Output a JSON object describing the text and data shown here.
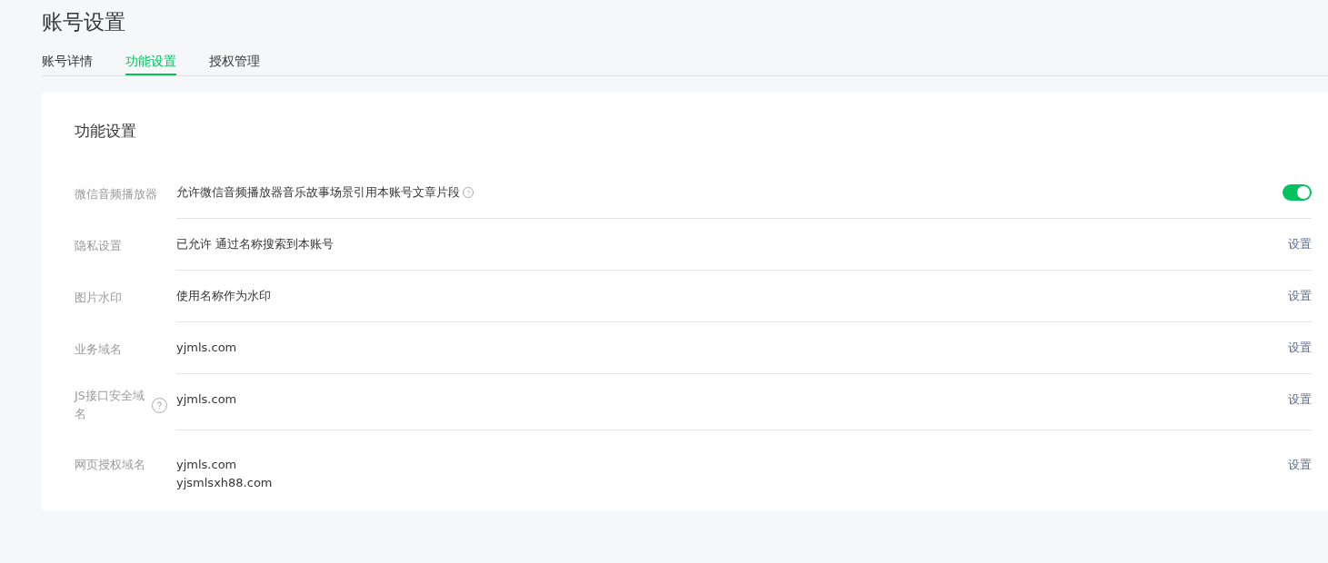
{
  "page_title": "账号设置",
  "tabs": [
    {
      "label": "账号详情",
      "selected": false
    },
    {
      "label": "功能设置",
      "selected": true
    },
    {
      "label": "授权管理",
      "selected": false
    }
  ],
  "card": {
    "title": "功能设置",
    "rows": [
      {
        "label": "微信音频播放器",
        "label_help": false,
        "values": [
          "允许微信音频播放器音乐故事场景引用本账号文章片段"
        ],
        "value_help": true,
        "kind": "toggle",
        "on": true
      },
      {
        "label": "隐私设置",
        "label_help": false,
        "values": [
          "已允许 通过名称搜索到本账号"
        ],
        "value_help": false,
        "kind": "link",
        "action": "设置"
      },
      {
        "label": "图片水印",
        "label_help": false,
        "values": [
          "使用名称作为水印"
        ],
        "value_help": false,
        "kind": "link",
        "action": "设置"
      },
      {
        "label": "业务域名",
        "label_help": false,
        "values": [
          "yjmls.com"
        ],
        "value_help": false,
        "kind": "link",
        "action": "设置"
      },
      {
        "label": "JS接口安全域名",
        "label_help": true,
        "values": [
          "yjmls.com"
        ],
        "value_help": false,
        "kind": "link",
        "action": "设置"
      },
      {
        "label": "网页授权域名",
        "label_help": false,
        "values": [
          "yjmls.com",
          "yjsmlsxh88.com"
        ],
        "value_help": false,
        "kind": "link",
        "action": "设置"
      }
    ]
  }
}
